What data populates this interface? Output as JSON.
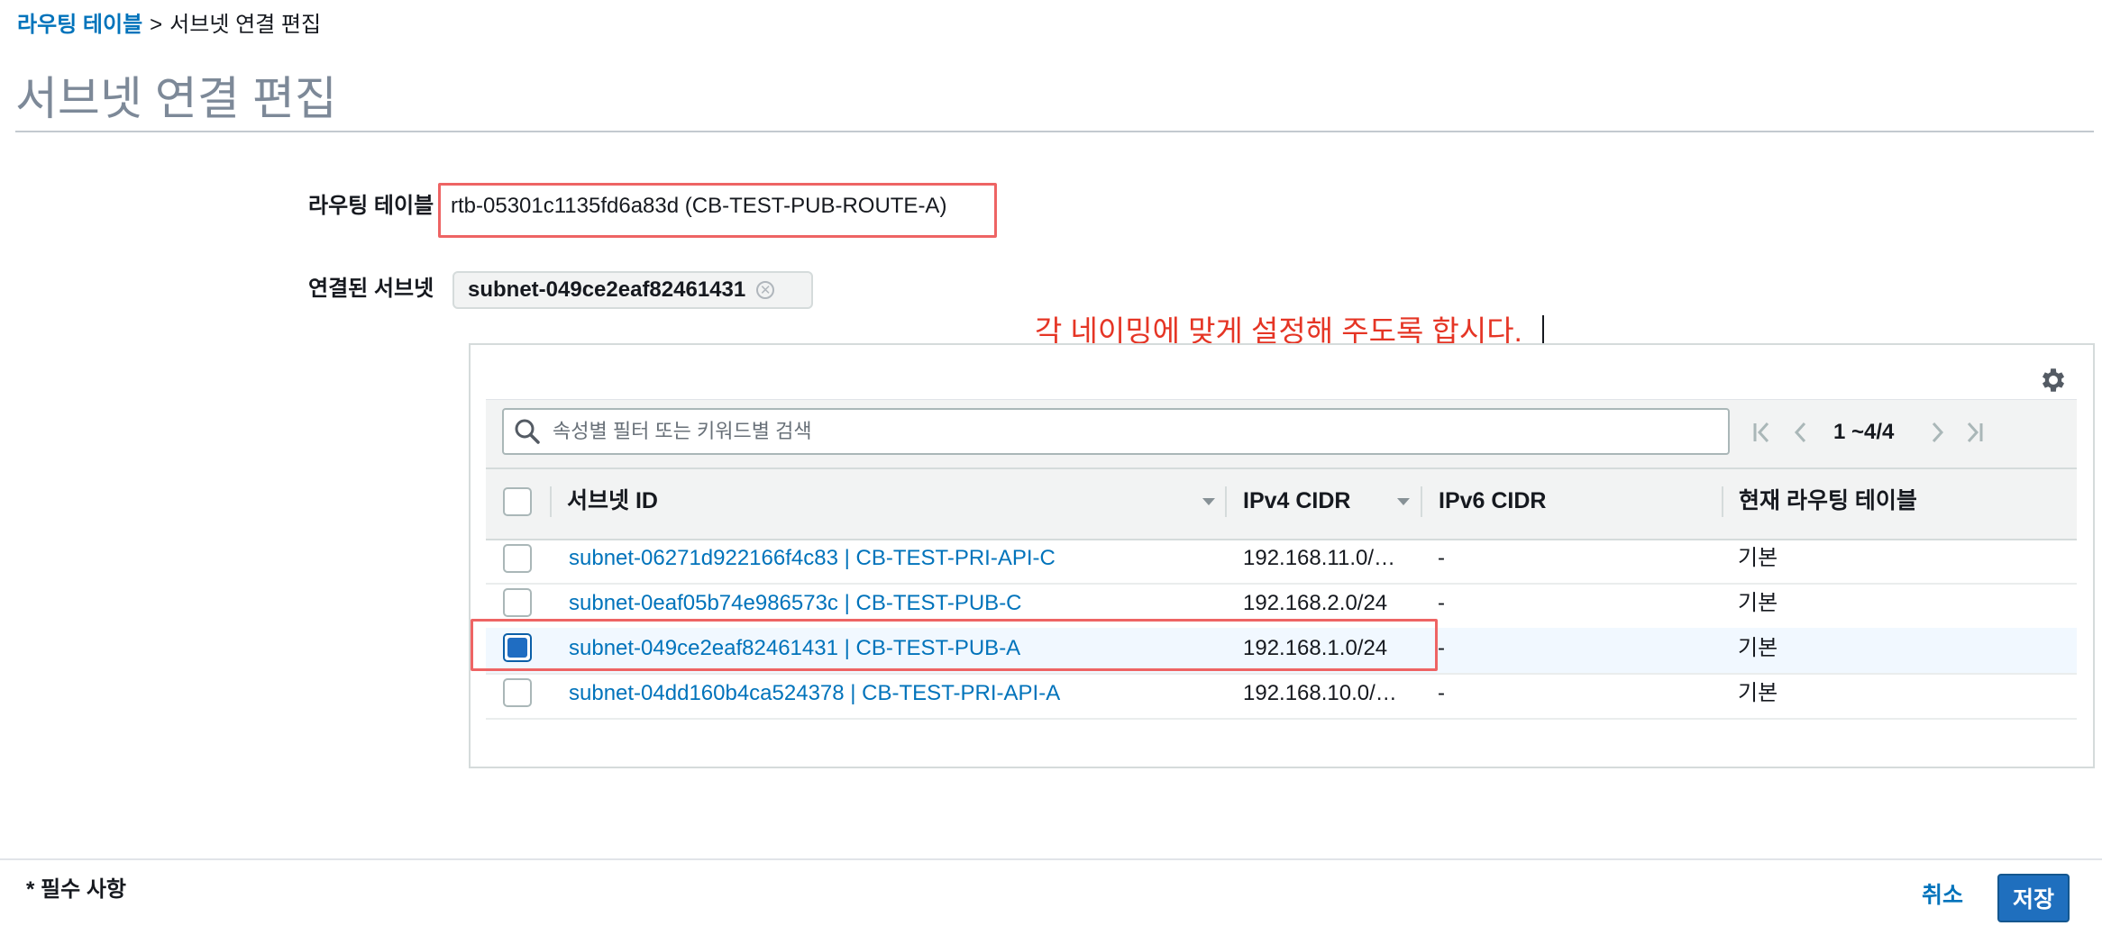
{
  "breadcrumb": {
    "parent": "라우팅 테이블",
    "separator": ">",
    "current": "서브넷 연결 편집"
  },
  "page_title": "서브넷 연결 편집",
  "form": {
    "route_table_label": "라우팅 테이블",
    "route_table_value": "rtb-05301c1135fd6a83d (CB-TEST-PUB-ROUTE-A)",
    "associated_label": "연결된 서브넷",
    "associated_token": "subnet-049ce2eaf82461431"
  },
  "annotation": "각 네이밍에 맞게 설정해 주도록 합시다.",
  "table": {
    "search_placeholder": "속성별 필터 또는 키워드별 검색",
    "pagination": "1 ~4/4",
    "columns": {
      "subnet_id": "서브넷 ID",
      "ipv4": "IPv4 CIDR",
      "ipv6": "IPv6 CIDR",
      "route_table": "현재 라우팅 테이블"
    },
    "rows": [
      {
        "subnet": "subnet-06271d922166f4c83 | CB-TEST-PRI-API-C",
        "ipv4": "192.168.11.0/…",
        "ipv6": "-",
        "route_table": "기본",
        "checked": false
      },
      {
        "subnet": "subnet-0eaf05b74e986573c | CB-TEST-PUB-C",
        "ipv4": "192.168.2.0/24",
        "ipv6": "-",
        "route_table": "기본",
        "checked": false
      },
      {
        "subnet": "subnet-049ce2eaf82461431 | CB-TEST-PUB-A",
        "ipv4": "192.168.1.0/24",
        "ipv6": "-",
        "route_table": "기본",
        "checked": true
      },
      {
        "subnet": "subnet-04dd160b4ca524378 | CB-TEST-PRI-API-A",
        "ipv4": "192.168.10.0/…",
        "ipv6": "-",
        "route_table": "기본",
        "checked": false
      }
    ]
  },
  "footer": {
    "required_note": "* 필수 사항",
    "cancel_label": "취소",
    "save_label": "저장"
  },
  "icons": {
    "search": "search-icon",
    "settings": "gear-icon",
    "first": "first-page-icon",
    "prev": "prev-page-icon",
    "next": "next-page-icon",
    "last": "last-page-icon",
    "remove": "remove-token-icon"
  },
  "colors": {
    "link": "#0073bb",
    "annotation": "#e53525",
    "highlight_box": "#ee6464",
    "primary_button": "#1f6fbe",
    "selected_row": "#f1f8ff"
  }
}
